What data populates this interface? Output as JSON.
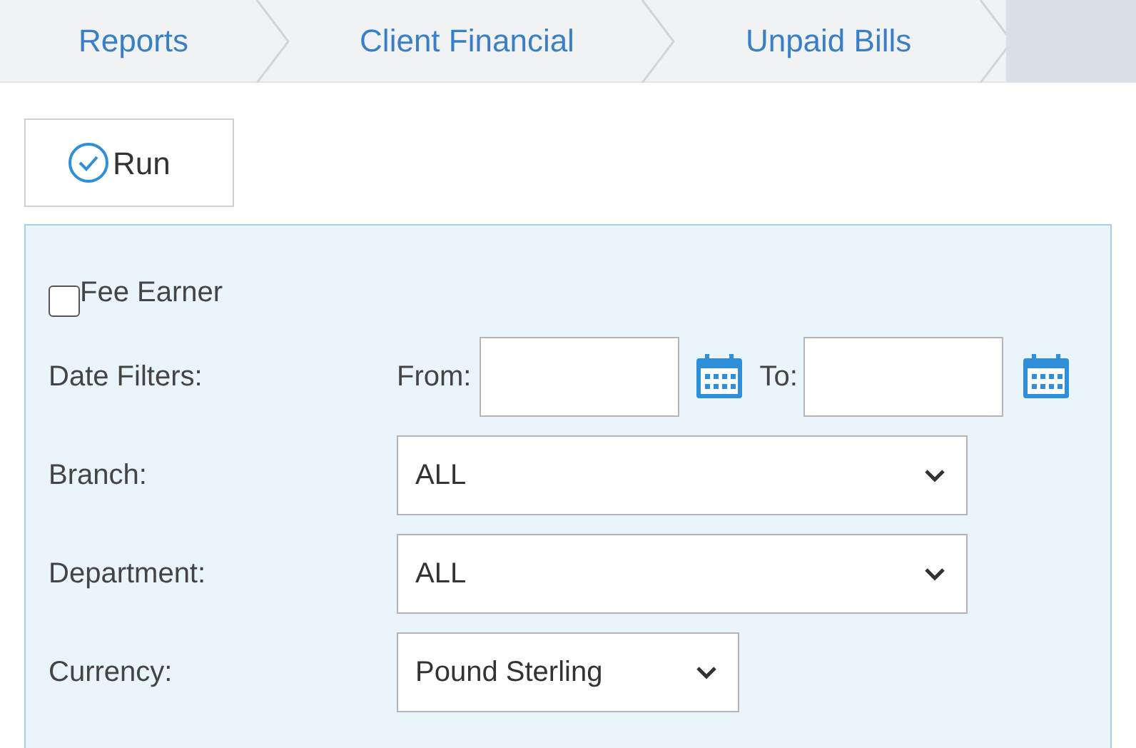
{
  "breadcrumbs": [
    {
      "label": "Reports"
    },
    {
      "label": "Client Financial"
    },
    {
      "label": "Unpaid Bills"
    }
  ],
  "run_button": {
    "label": "Run"
  },
  "fee_earner": {
    "label": "Fee Earner",
    "checked": false
  },
  "date_filters": {
    "label": "Date Filters:",
    "from_label": "From:",
    "to_label": "To:"
  },
  "selects": [
    {
      "label": "Branch:",
      "value": "ALL"
    },
    {
      "label": "Department:",
      "value": "ALL"
    },
    {
      "label": "Currency:",
      "value": "Pound Sterling"
    }
  ]
}
